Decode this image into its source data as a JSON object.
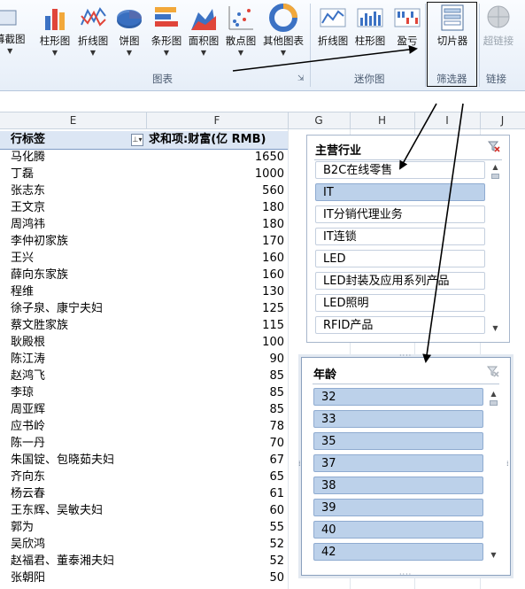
{
  "ribbon": {
    "buttons": [
      {
        "label": "幕截图",
        "name": "screenshot-button"
      },
      {
        "label": "柱形图",
        "name": "column-chart-button"
      },
      {
        "label": "折线图",
        "name": "line-chart-button"
      },
      {
        "label": "饼图",
        "name": "pie-chart-button"
      },
      {
        "label": "条形图",
        "name": "bar-chart-button"
      },
      {
        "label": "面积图",
        "name": "area-chart-button"
      },
      {
        "label": "散点图",
        "name": "scatter-chart-button"
      },
      {
        "label": "其他图表",
        "name": "other-charts-button"
      },
      {
        "label": "折线图",
        "name": "sparkline-line-button"
      },
      {
        "label": "柱形图",
        "name": "sparkline-column-button"
      },
      {
        "label": "盈亏",
        "name": "sparkline-winloss-button"
      },
      {
        "label": "切片器",
        "name": "slicer-button"
      },
      {
        "label": "超链接",
        "name": "hyperlink-button"
      }
    ],
    "groups": {
      "charts": "图表",
      "sparklines": "迷你图",
      "filter": "筛选器",
      "links": "链接"
    }
  },
  "columns": [
    "E",
    "F",
    "G",
    "H",
    "I",
    "J"
  ],
  "pivot": {
    "row_label_header": "行标签",
    "value_header": "求和项:财富(亿 RMB)",
    "rows": [
      {
        "name": "马化腾",
        "value": "1650"
      },
      {
        "name": "丁磊",
        "value": "1000"
      },
      {
        "name": "张志东",
        "value": "560"
      },
      {
        "name": "王文京",
        "value": "180"
      },
      {
        "name": "周鸿祎",
        "value": "180"
      },
      {
        "name": "李仲初家族",
        "value": "170"
      },
      {
        "name": "王兴",
        "value": "160"
      },
      {
        "name": "薛向东家族",
        "value": "160"
      },
      {
        "name": "程维",
        "value": "130"
      },
      {
        "name": "徐子泉、康宁夫妇",
        "value": "125"
      },
      {
        "name": "蔡文胜家族",
        "value": "115"
      },
      {
        "name": "耿殿根",
        "value": "100"
      },
      {
        "name": "陈江涛",
        "value": "90"
      },
      {
        "name": "赵鸿飞",
        "value": "85"
      },
      {
        "name": "李琼",
        "value": "85"
      },
      {
        "name": "周亚辉",
        "value": "85"
      },
      {
        "name": "应书岭",
        "value": "78"
      },
      {
        "name": "陈一丹",
        "value": "70"
      },
      {
        "name": "朱国锭、包晓茹夫妇",
        "value": "67"
      },
      {
        "name": "齐向东",
        "value": "65"
      },
      {
        "name": "杨云春",
        "value": "61"
      },
      {
        "name": "王东辉、吴敏夫妇",
        "value": "60"
      },
      {
        "name": "郭为",
        "value": "55"
      },
      {
        "name": "吴欣鸿",
        "value": "52"
      },
      {
        "name": "赵福君、董泰湘夫妇",
        "value": "52"
      },
      {
        "name": "张朝阳",
        "value": "50"
      }
    ]
  },
  "slicer_industry": {
    "title": "主营行业",
    "items": [
      {
        "label": "B2C在线零售",
        "selected": false
      },
      {
        "label": "IT",
        "selected": true
      },
      {
        "label": "IT分销代理业务",
        "selected": false
      },
      {
        "label": "IT连锁",
        "selected": false
      },
      {
        "label": "LED",
        "selected": false
      },
      {
        "label": "LED封装及应用系列产品",
        "selected": false
      },
      {
        "label": "LED照明",
        "selected": false
      },
      {
        "label": "RFID产品",
        "selected": false
      }
    ]
  },
  "slicer_age": {
    "title": "年龄",
    "items": [
      {
        "label": "32",
        "selected": true
      },
      {
        "label": "33",
        "selected": true
      },
      {
        "label": "35",
        "selected": true
      },
      {
        "label": "37",
        "selected": true
      },
      {
        "label": "38",
        "selected": true
      },
      {
        "label": "39",
        "selected": true
      },
      {
        "label": "40",
        "selected": true
      },
      {
        "label": "42",
        "selected": true
      }
    ]
  },
  "colors": {
    "selected_item": "#bcd1ea",
    "pivot_header": "#dce6f4",
    "ribbon": "#e6eef8"
  }
}
